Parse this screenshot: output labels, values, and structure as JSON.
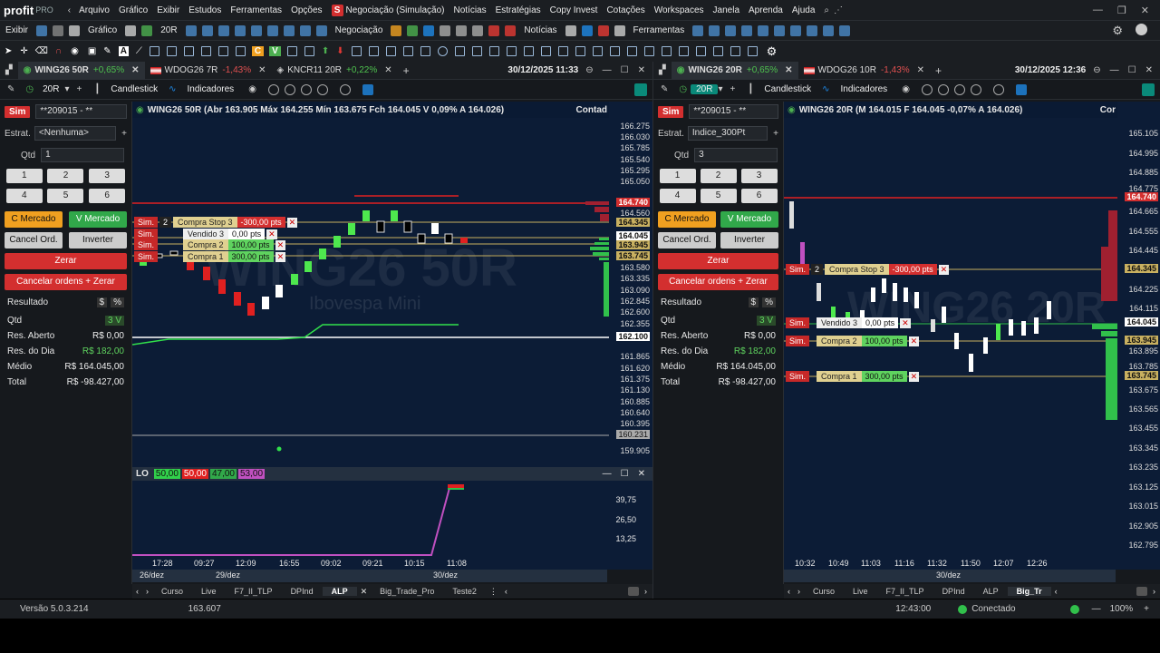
{
  "menu": {
    "logo": "profit",
    "logo_suffix": "PRO",
    "items": [
      "Arquivo",
      "Gráfico",
      "Exibir",
      "Estudos",
      "Ferramentas",
      "Opções"
    ],
    "sim": "Negociação (Simulação)",
    "items2": [
      "Notícias",
      "Estratégias",
      "Copy Invest",
      "Cotações",
      "Workspaces",
      "Janela",
      "Aprenda",
      "Ajuda"
    ]
  },
  "toolbar": {
    "exibir": "Exibir",
    "grafico": "Gráfico",
    "period": "20R",
    "negociacao": "Negociação",
    "noticias": "Notícias",
    "ferramentas": "Ferramentas"
  },
  "left_panel": {
    "tabs": [
      {
        "name": "WING26 50R",
        "change": "+0,65%",
        "dir": "up"
      },
      {
        "name": "WDOG26 7R",
        "change": "-1,43%",
        "dir": "down"
      },
      {
        "name": "KNCR11 20R",
        "change": "+0,22%",
        "dir": "up"
      }
    ],
    "datetime": "30/12/2025 11:33",
    "period": "20R",
    "chart_type": "Candlestick",
    "indicators": "Indicadores",
    "account": "**209015 - **",
    "strategy_label": "Estrat.",
    "strategy_value": "<Nenhuma>",
    "qty_label": "Qtd",
    "qty_value": "1",
    "summary": "WING26 50R  (Abr 163.905 Máx 164.255 Mín 163.675 Fch 164.045 V 0,09% A 164.026)",
    "contador": "Contad",
    "watermark": "WING26 50R",
    "watermark_sub": "Ibovespa Mini",
    "price_labels": [
      "166.275",
      "166.030",
      "165.785",
      "165.540",
      "165.295",
      "165.050",
      "164.740",
      "164.560",
      "164.345",
      "164.045",
      "163.945",
      "163.745",
      "163.580",
      "163.335",
      "163.090",
      "162.845",
      "162.600",
      "162.355",
      "162.100",
      "161.865",
      "161.620",
      "161.375",
      "161.130",
      "160.885",
      "160.640",
      "160.395",
      "160.231",
      "159.905"
    ],
    "orders": [
      {
        "sim": "Sim.",
        "qty": "2",
        "name": "Compra Stop 3",
        "val": "-300,00 pts"
      },
      {
        "sim": "Sim.",
        "name": "Vendido 3",
        "val": "0,00 pts"
      },
      {
        "sim": "Sim.",
        "name": "Compra 2",
        "val": "100,00 pts"
      },
      {
        "sim": "Sim.",
        "name": "Compra 1",
        "val": "300,00 pts"
      }
    ],
    "lo": {
      "label": "LO",
      "v1": "50,00",
      "v2": "50,00",
      "v3": "47,00",
      "v4": "53,00",
      "scale": [
        "39,75",
        "26,50",
        "13,25"
      ]
    },
    "xaxis": [
      "17:28",
      "09:27",
      "12:09",
      "16:55",
      "09:02",
      "09:21",
      "10:15",
      "11:08"
    ],
    "dates": [
      "26/dez",
      "29/dez",
      "30/dez"
    ],
    "bottom_tabs": [
      "Curso",
      "Live",
      "F7_II_TLP",
      "DPInd",
      "ALP",
      "Big_Trade_Pro",
      "Teste2"
    ]
  },
  "right_panel": {
    "tabs": [
      {
        "name": "WING26 20R",
        "change": "+0,65%",
        "dir": "up"
      },
      {
        "name": "WDOG26 10R",
        "change": "-1,43%",
        "dir": "down"
      }
    ],
    "datetime": "30/12/2025 12:36",
    "period": "20R",
    "chart_type": "Candlestick",
    "indicators": "Indicadores",
    "account": "**209015 - **",
    "strategy_label": "Estrat.",
    "strategy_value": "Indice_300Pt",
    "qty_label": "Qtd",
    "qty_value": "3",
    "summary": "WING26 20R  (M 164.015 F 164.045 -0,07% A 164.026)",
    "contador": "Cor",
    "watermark": "WING26 20R",
    "price_labels": [
      "165.105",
      "164.995",
      "164.885",
      "164.775",
      "164.740",
      "164.665",
      "164.555",
      "164.445",
      "164.345",
      "164.225",
      "164.115",
      "164.045",
      "163.945",
      "163.895",
      "163.785",
      "163.745",
      "163.675",
      "163.565",
      "163.455",
      "163.345",
      "163.235",
      "163.125",
      "163.015",
      "162.905",
      "162.795"
    ],
    "orders": [
      {
        "sim": "Sim.",
        "qty": "2",
        "name": "Compra Stop 3",
        "val": "-300,00 pts"
      },
      {
        "sim": "Sim.",
        "name": "Vendido 3",
        "val": "0,00 pts"
      },
      {
        "sim": "Sim.",
        "name": "Compra 2",
        "val": "100,00 pts"
      },
      {
        "sim": "Sim.",
        "name": "Compra 1",
        "val": "300,00 pts"
      }
    ],
    "xaxis": [
      "10:32",
      "10:49",
      "11:03",
      "11:16",
      "11:32",
      "11:50",
      "12:07",
      "12:26"
    ],
    "dates": [
      "30/dez"
    ],
    "bottom_tabs": [
      "Curso",
      "Live",
      "F7_II_TLP",
      "DPInd",
      "ALP",
      "Big_Tr"
    ]
  },
  "boleta": {
    "keys": [
      "1",
      "2",
      "3",
      "4",
      "5",
      "6"
    ],
    "c_mercado": "C Mercado",
    "v_mercado": "V Mercado",
    "cancel": "Cancel Ord.",
    "inverter": "Inverter",
    "zerar": "Zerar",
    "cancel_all": "Cancelar ordens + Zerar",
    "resultado": "Resultado",
    "qtd_label": "Qtd",
    "qtd_value": "3 V",
    "res_aberto_label": "Res. Aberto",
    "res_aberto_value": "R$ 0,00",
    "res_dia_label": "Res. do Dia",
    "res_dia_value": "R$ 182,00",
    "medio_label": "Médio",
    "medio_value": "R$ 164.045,00",
    "total_label": "Total",
    "total_value": "R$ -98.427,00",
    "sim": "Sim"
  },
  "status": {
    "version": "Versão 5.0.3.214",
    "price": "163.607",
    "time": "12:43:00",
    "conn": "Conectado",
    "zoom": "100%"
  }
}
